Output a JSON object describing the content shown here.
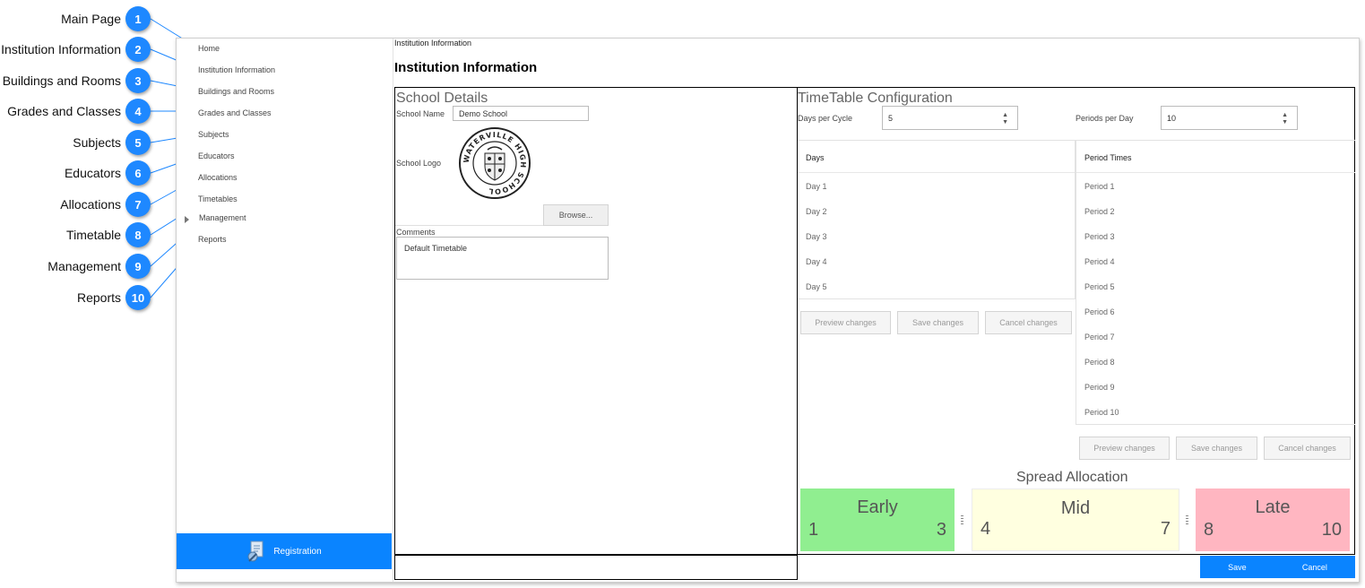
{
  "callouts": [
    {
      "num": "1",
      "label": "Main Page"
    },
    {
      "num": "2",
      "label": "Institution Information"
    },
    {
      "num": "3",
      "label": "Buildings and Rooms"
    },
    {
      "num": "4",
      "label": "Grades and Classes"
    },
    {
      "num": "5",
      "label": "Subjects"
    },
    {
      "num": "6",
      "label": "Educators"
    },
    {
      "num": "7",
      "label": "Allocations"
    },
    {
      "num": "8",
      "label": "Timetable"
    },
    {
      "num": "9",
      "label": "Management"
    },
    {
      "num": "10",
      "label": "Reports"
    }
  ],
  "nav": {
    "items": [
      "Home",
      "Institution Information",
      "Buildings and Rooms",
      "Grades and Classes",
      "Subjects",
      "Educators",
      "Allocations",
      "Timetables",
      "Management",
      "Reports"
    ],
    "registration_label": "Registration"
  },
  "breadcrumb": "Institution Information",
  "page_title": "Institution Information",
  "school": {
    "title": "School Details",
    "name_label": "School Name",
    "name_value": "Demo School",
    "logo_label": "School Logo",
    "logo_text_top": "WATERVILLE HIGH SCHOOL",
    "browse_label": "Browse...",
    "comments_label": "Comments",
    "comments_value": "Default Timetable"
  },
  "timetable": {
    "title": "TimeTable Configuration",
    "days_per_cycle_label": "Days per Cycle",
    "days_per_cycle_value": "5",
    "periods_per_day_label": "Periods per Day",
    "periods_per_day_value": "10",
    "days_header": "Days",
    "days": [
      "Day 1",
      "Day 2",
      "Day 3",
      "Day 4",
      "Day 5"
    ],
    "periods_header": "Period Times",
    "periods": [
      "Period 1",
      "Period 2",
      "Period 3",
      "Period 4",
      "Period 5",
      "Period 6",
      "Period 7",
      "Period 8",
      "Period 9",
      "Period 10"
    ],
    "preview_label": "Preview changes",
    "save_changes_label": "Save changes",
    "cancel_changes_label": "Cancel changes"
  },
  "spread": {
    "title": "Spread Allocation",
    "bands": [
      {
        "name": "Early",
        "from": "1",
        "to": "3",
        "color": "#90ee90"
      },
      {
        "name": "Mid",
        "from": "4",
        "to": "7",
        "color": "#ffffe0"
      },
      {
        "name": "Late",
        "from": "8",
        "to": "10",
        "color": "#ffb6c1"
      }
    ]
  },
  "footer": {
    "save_label": "Save",
    "cancel_label": "Cancel"
  },
  "colors": {
    "accent": "#0a84ff",
    "badge": "#1e88ff"
  }
}
